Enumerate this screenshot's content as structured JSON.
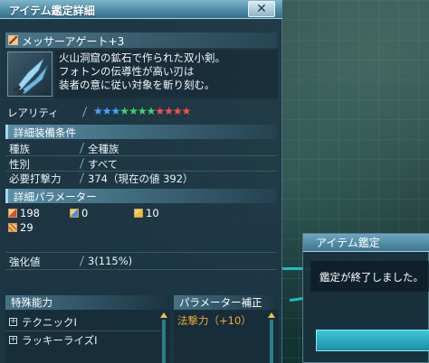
{
  "window": {
    "title": "アイテム鑑定詳細",
    "close_label": "✕"
  },
  "item": {
    "name": "メッサーアゲート+3",
    "description_lines": [
      "火山洞窟の鉱石で作られた双小剣。",
      "フォトンの伝導性が高い刃は",
      "装者の意に従い対象を斬り刻む。"
    ]
  },
  "rarity": {
    "label": "レアリティ",
    "stars": 11,
    "star_colors": [
      "#4aa3ff",
      "#4aa3ff",
      "#4aa3ff",
      "#45d16a",
      "#45d16a",
      "#45d16a",
      "#45d16a",
      "#ff4d4d",
      "#ff4d4d",
      "#ff4d4d",
      "#ff4d4d"
    ]
  },
  "equip_section": {
    "title": "詳細装備条件",
    "rows": [
      {
        "key": "種族",
        "value": "全種族"
      },
      {
        "key": "性別",
        "value": "すべて"
      },
      {
        "key": "必要打撃力",
        "value": "374（現在の値 392）"
      }
    ]
  },
  "params_section": {
    "title": "詳細パラメーター",
    "items": [
      {
        "icon": "strike-icon",
        "value": "198",
        "color": "#d84b3c"
      },
      {
        "icon": "range-icon",
        "value": "0",
        "color": "#4a8de0"
      },
      {
        "icon": "tech-icon",
        "value": "10",
        "color": "#e8c040"
      },
      {
        "icon": "dex-icon",
        "value": "29",
        "color": "#d07040"
      }
    ]
  },
  "grind": {
    "label": "強化値",
    "value": "3(115%)"
  },
  "special": {
    "title": "特殊能力",
    "items": [
      "テクニックI",
      "ラッキーライズI"
    ]
  },
  "param_bonus": {
    "title": "パラメーター補正",
    "items": [
      "法撃力（+10）"
    ]
  },
  "dialog": {
    "title": "アイテム鑑定",
    "message": "鑑定が終了しました。"
  },
  "colors": {
    "accent": "#4f8aa6",
    "star_gold": "#f0c040",
    "bonus_highlight": "#f0a830"
  }
}
